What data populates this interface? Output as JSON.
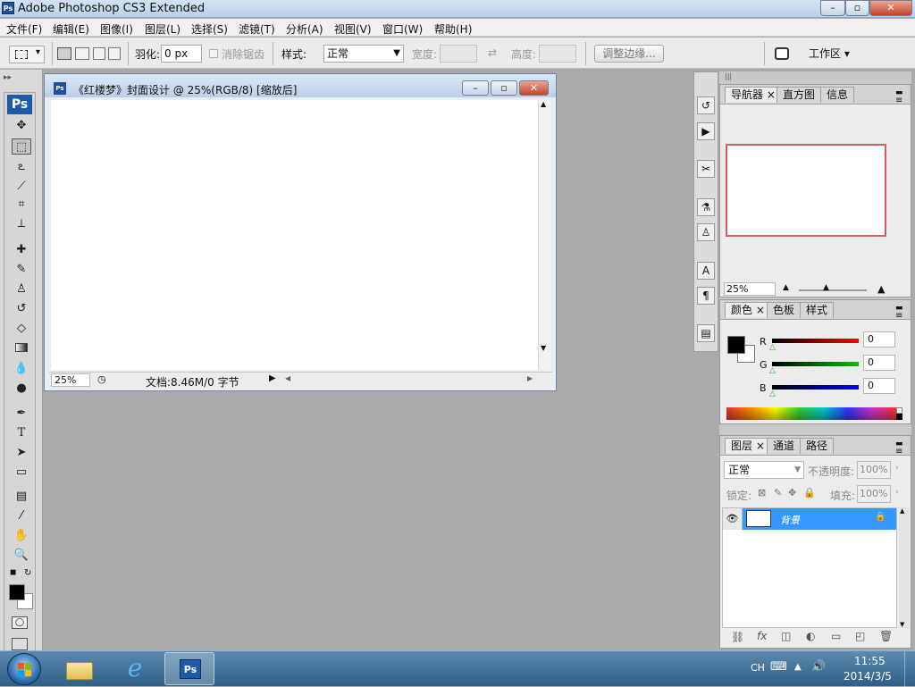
{
  "app": {
    "title": "Adobe Photoshop CS3 Extended",
    "icon": "Ps"
  },
  "window_controls": {
    "minimize": "–",
    "maximize": "▫",
    "close": "✕"
  },
  "menu": [
    "文件(F)",
    "编辑(E)",
    "图像(I)",
    "图层(L)",
    "选择(S)",
    "滤镜(T)",
    "分析(A)",
    "视图(V)",
    "窗口(W)",
    "帮助(H)"
  ],
  "options": {
    "feather_label": "羽化:",
    "feather_value": "0 px",
    "antialias_label": "消除锯齿",
    "style_label": "样式:",
    "style_value": "正常",
    "width_label": "宽度:",
    "height_label": "高度:",
    "refine_edge": "调整边缘...",
    "workspace": "工作区 ▾"
  },
  "document": {
    "title": "《红楼梦》封面设计 @ 25%(RGB/8) [缩放后]",
    "zoom": "25%",
    "doc_info": "文档:8.46M/0 字节"
  },
  "navigator": {
    "tabs": [
      "导航器",
      "直方图",
      "信息"
    ],
    "zoom": "25%"
  },
  "color": {
    "tabs": [
      "颜色",
      "色板",
      "样式"
    ],
    "channels": [
      {
        "label": "R",
        "value": "0"
      },
      {
        "label": "G",
        "value": "0"
      },
      {
        "label": "B",
        "value": "0"
      }
    ]
  },
  "layers": {
    "tabs": [
      "图层",
      "通道",
      "路径"
    ],
    "blend_mode": "正常",
    "opacity_label": "不透明度:",
    "opacity_value": "100%",
    "lock_label": "锁定:",
    "fill_label": "填充:",
    "fill_value": "100%",
    "items": [
      {
        "name": "背景"
      }
    ]
  },
  "taskbar": {
    "lang": "CH",
    "time": "11:55",
    "date": "2014/3/5"
  },
  "colors": {
    "accent": "#3399ff",
    "title_blue": "#b9cfe8",
    "nav_frame": "#d06060"
  }
}
